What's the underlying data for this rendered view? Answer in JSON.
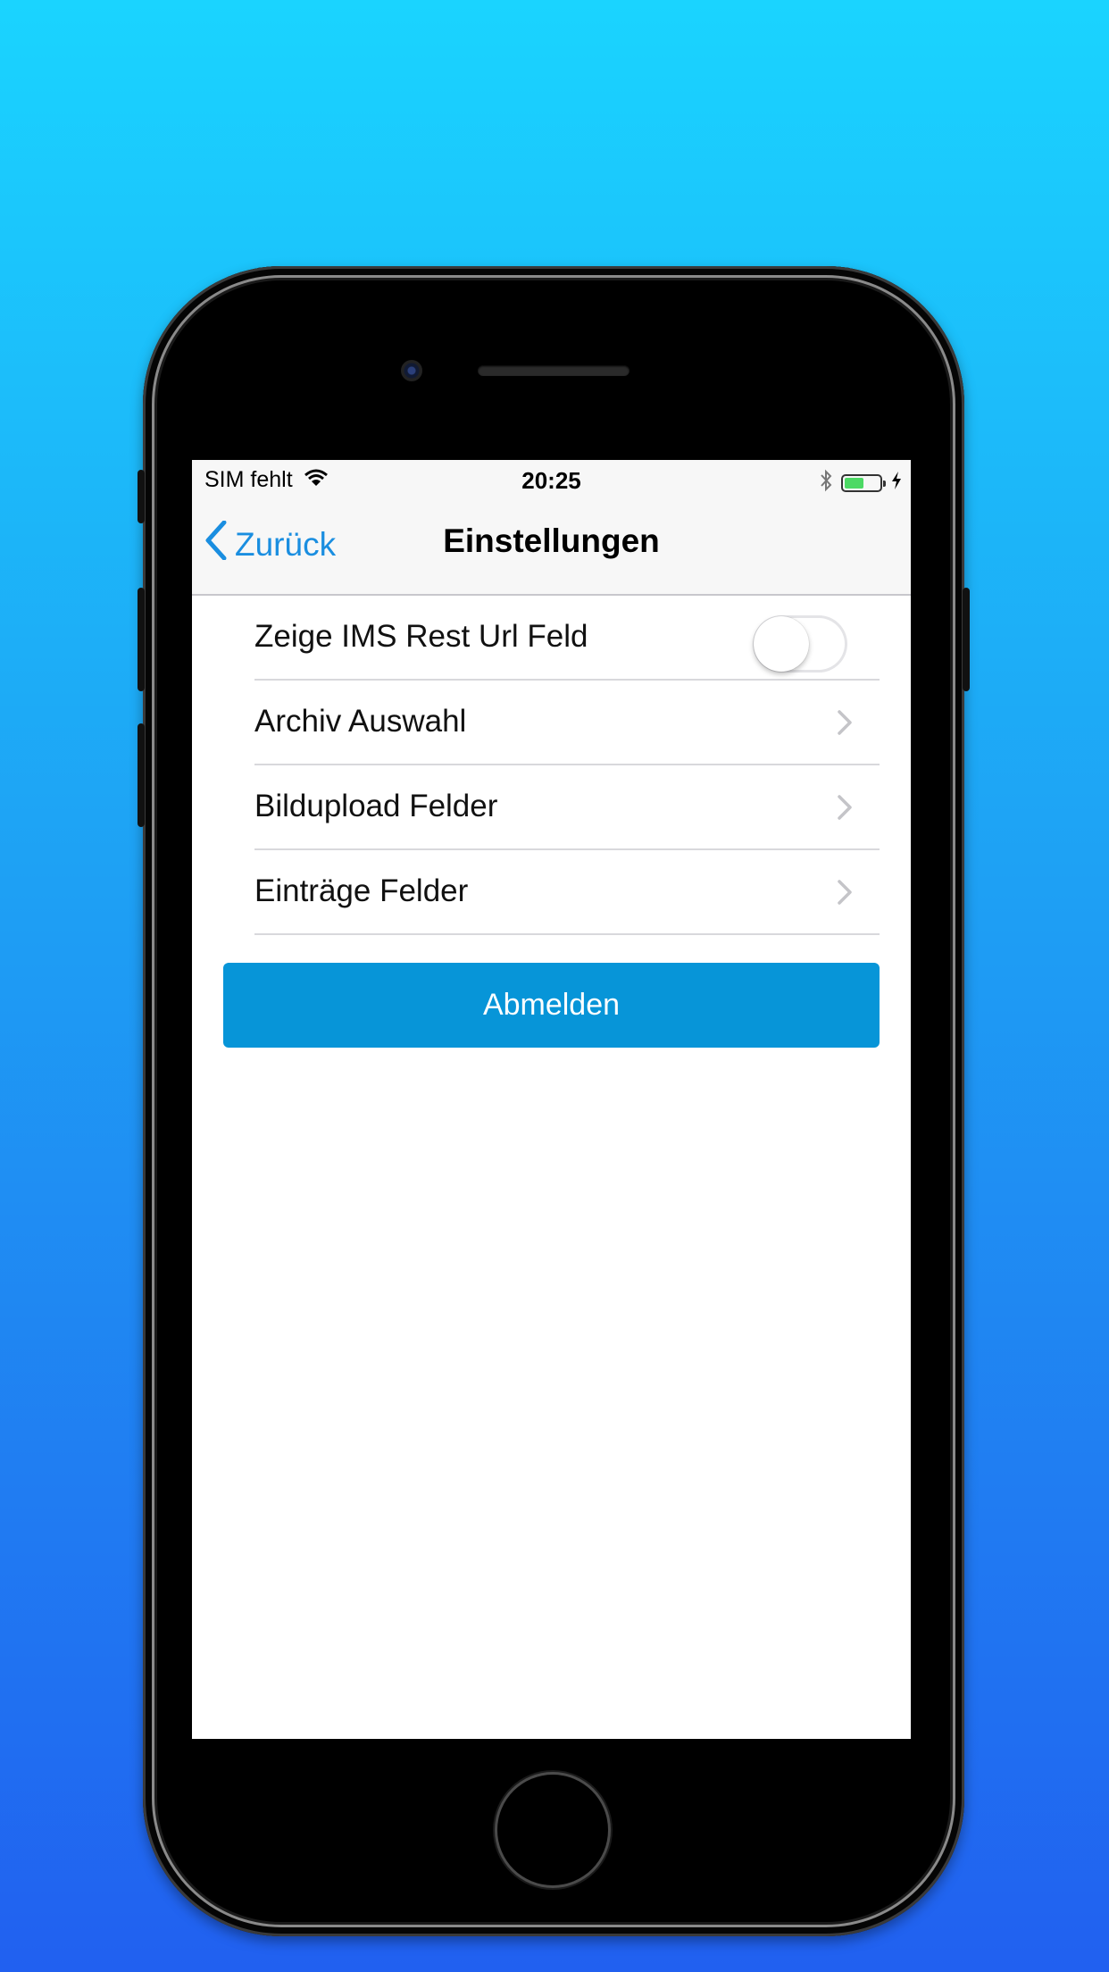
{
  "status_bar": {
    "carrier": "SIM fehlt",
    "time": "20:25",
    "battery_level": 0.55,
    "icons": [
      "wifi-icon",
      "bluetooth-icon",
      "battery-icon",
      "charging-icon"
    ]
  },
  "nav": {
    "back_label": "Zurück",
    "title": "Einstellungen"
  },
  "settings": {
    "toggle_row": {
      "label": "Zeige IMS Rest Url Feld",
      "enabled": false
    },
    "items": [
      {
        "label": "Archiv Auswahl"
      },
      {
        "label": "Bildupload Felder"
      },
      {
        "label": "Einträge Felder"
      }
    ]
  },
  "logout_label": "Abmelden",
  "colors": {
    "accent": "#1a8ee0",
    "button": "#0795d8",
    "background_top": "#1ad4ff",
    "background_bottom": "#2160f0"
  }
}
